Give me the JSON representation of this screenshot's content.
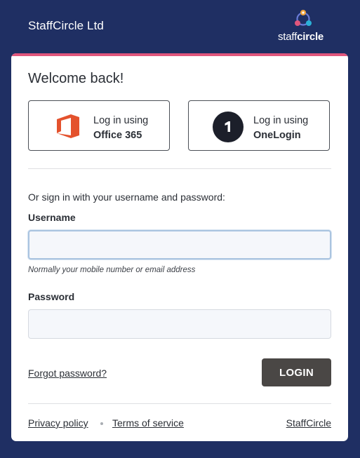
{
  "header": {
    "company_name": "StaffCircle Ltd",
    "brand_prefix": "staff",
    "brand_suffix": "circle"
  },
  "card": {
    "title": "Welcome back!",
    "accent_color": "#e0567c"
  },
  "sso": {
    "office365": {
      "prefix": "Log in using",
      "provider": "Office 365",
      "icon": "office-365-icon"
    },
    "onelogin": {
      "prefix": "Log in using",
      "provider": "OneLogin",
      "icon": "onelogin-icon"
    }
  },
  "form": {
    "alt_text": "Or sign in with your username and password:",
    "username_label": "Username",
    "username_value": "",
    "username_hint": "Normally your mobile number or email address",
    "password_label": "Password",
    "password_value": "",
    "forgot_label": "Forgot password?",
    "login_label": "LOGIN"
  },
  "footer": {
    "privacy": "Privacy policy",
    "terms": "Terms of service",
    "brand_link": "StaffCircle"
  },
  "colors": {
    "background": "#1f2f63",
    "login_button": "#4a4745",
    "office_orange": "#e4522d"
  }
}
